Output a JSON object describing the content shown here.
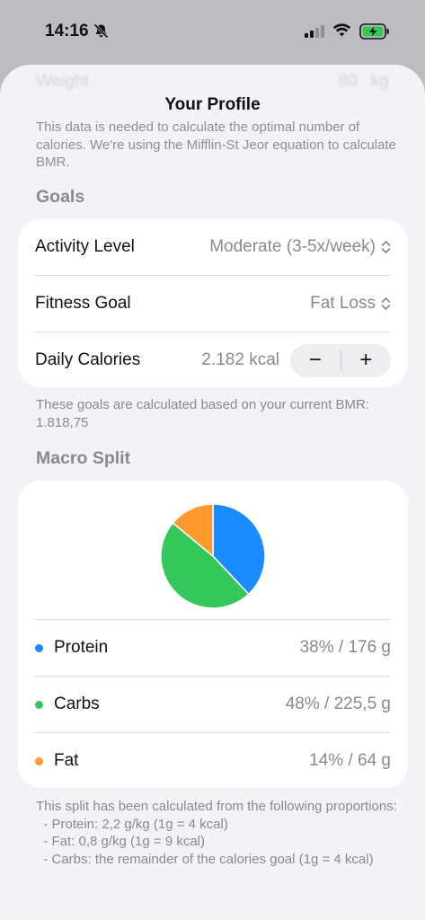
{
  "status_bar": {
    "time": "14:16",
    "icons": [
      "bell-slash-icon",
      "signal-icon",
      "wifi-icon",
      "battery-charging-icon"
    ]
  },
  "sheet": {
    "title": "Your Profile",
    "ghost_row": {
      "label": "Weight",
      "value": "80",
      "unit": "kg"
    },
    "bmr_note": "This data is needed to calculate the optimal number of calories. We're using the Mifflin-St Jeor equation to calculate BMR."
  },
  "goals": {
    "header": "Goals",
    "activity": {
      "label": "Activity Level",
      "value": "Moderate (3-5x/week)"
    },
    "fitness": {
      "label": "Fitness Goal",
      "value": "Fat Loss"
    },
    "calories": {
      "label": "Daily Calories",
      "value": "2.182 kcal",
      "minus": "−",
      "plus": "+"
    },
    "note": "These goals are calculated based on your current BMR: 1.818,75"
  },
  "macro": {
    "header": "Macro Split",
    "items": [
      {
        "label": "Protein",
        "value": "38% / 176 g",
        "color": "#1a8cff"
      },
      {
        "label": "Carbs",
        "value": "48% / 225,5 g",
        "color": "#34c759"
      },
      {
        "label": "Fat",
        "value": "14% / 64 g",
        "color": "#ff9a2e"
      }
    ],
    "note_intro": "This split has been calculated from the following proportions:",
    "note_lines": [
      "  - Protein: 2,2 g/kg (1g = 4 kcal)",
      "  - Fat: 0,8 g/kg (1g = 9 kcal)",
      "  - Carbs: the remainder of the calories goal (1g = 4 kcal)"
    ]
  },
  "chart_data": {
    "type": "pie",
    "categories": [
      "Protein",
      "Carbs",
      "Fat"
    ],
    "values": [
      38,
      48,
      14
    ],
    "colors": [
      "#1a8cff",
      "#34c759",
      "#ff9a2e"
    ]
  }
}
